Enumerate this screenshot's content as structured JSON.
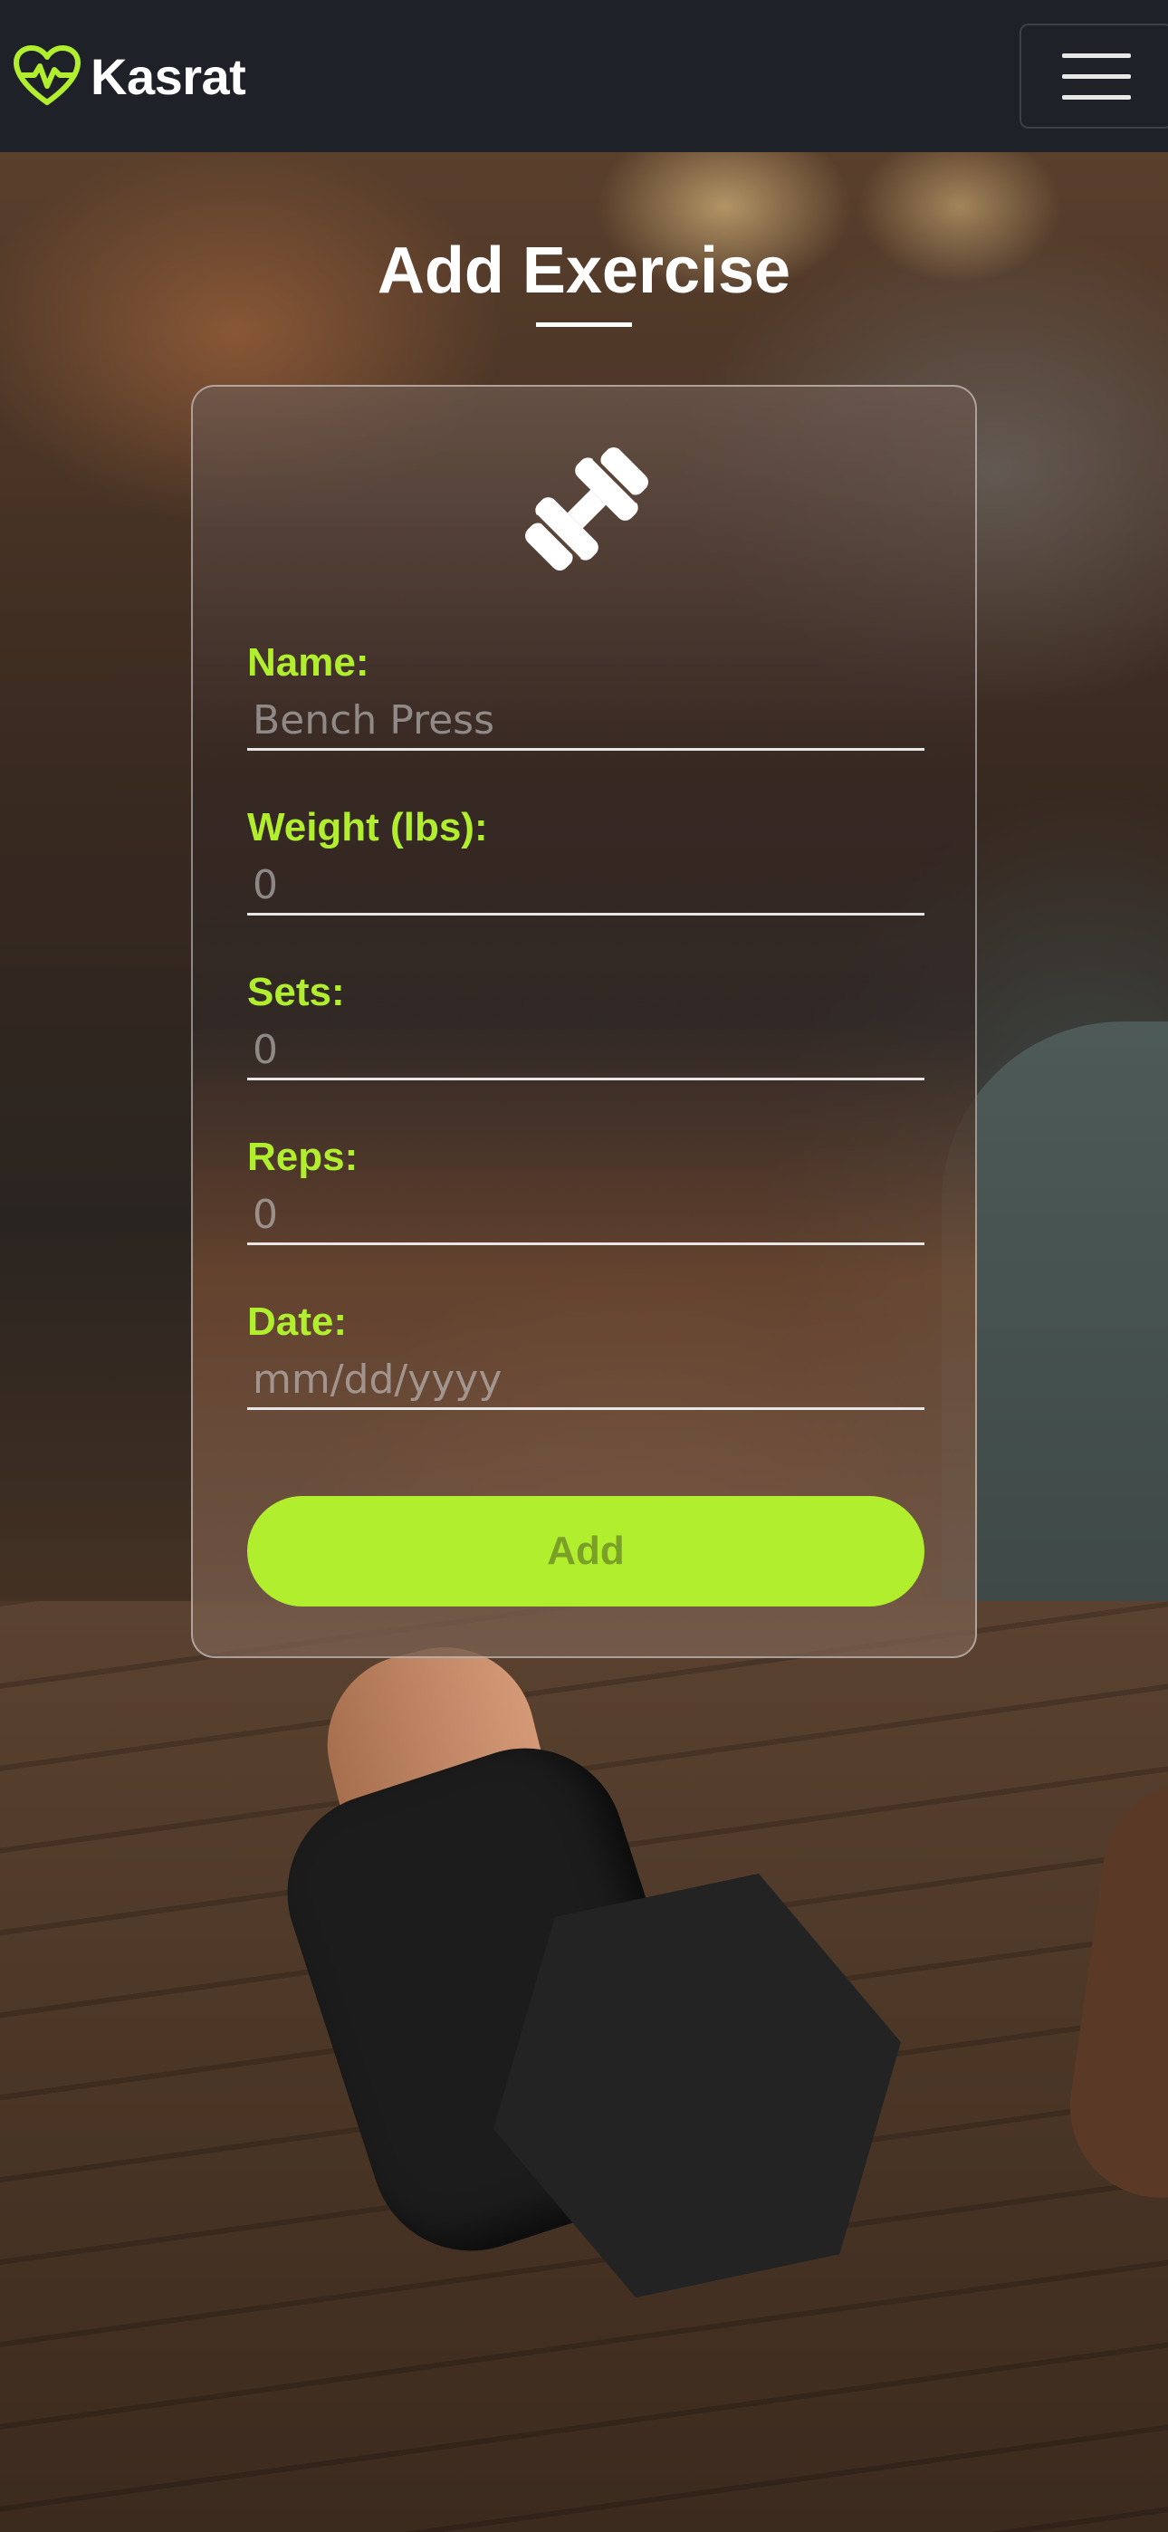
{
  "header": {
    "brand_name": "Kasrat",
    "logo_icon": "heart-pulse-icon",
    "menu_icon": "hamburger-menu-icon"
  },
  "page": {
    "title": "Add Exercise"
  },
  "form": {
    "icon": "dumbbell-icon",
    "fields": [
      {
        "label": "Name:",
        "placeholder": "Bench Press"
      },
      {
        "label": "Weight (lbs):",
        "placeholder": "0"
      },
      {
        "label": "Sets:",
        "placeholder": "0"
      },
      {
        "label": "Reps:",
        "placeholder": "0"
      },
      {
        "label": "Date:",
        "placeholder": "mm/dd/yyyy"
      }
    ],
    "submit_label": "Add"
  },
  "colors": {
    "accent": "#b0ee2e",
    "navbar": "#1e2128",
    "text": "#ffffff"
  }
}
